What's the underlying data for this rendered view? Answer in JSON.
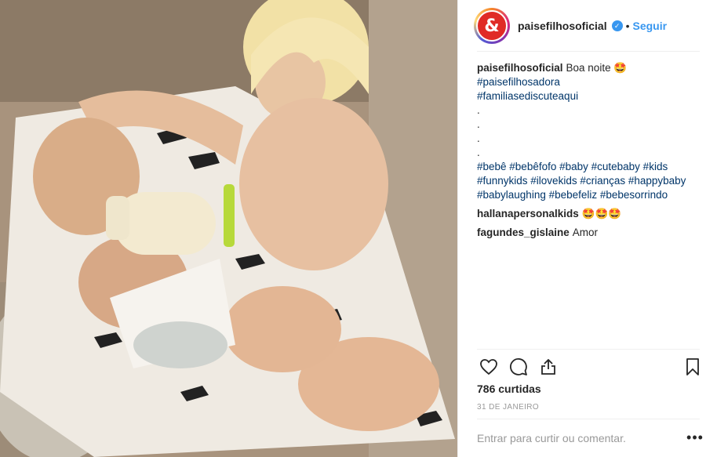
{
  "header": {
    "avatar_glyph": "&",
    "username": "paisefilhosoficial",
    "verified_mark": "✓",
    "separator": "•",
    "follow_label": "Seguir"
  },
  "caption": {
    "username": "paisefilhosoficial",
    "text": "Boa noite 🤩",
    "tags_a": [
      "#paisefilhosadora",
      "#familiasediscuteaqui"
    ],
    "dots": [
      ".",
      ".",
      ".",
      "."
    ],
    "tag_lines": [
      "#bebê #bebêfofo #baby #cutebaby #kids",
      "#funnykids #ilovekids #crianças #happybaby",
      "#babylaughing #bebefeliz #bebesorrindo"
    ]
  },
  "comments": [
    {
      "username": "hallanapersonalkids",
      "text": "🤩🤩🤩"
    },
    {
      "username": "fagundes_gislaine",
      "text": "Amor"
    }
  ],
  "actions": {
    "icons": [
      "heart-icon",
      "comment-icon",
      "share-icon",
      "bookmark-icon"
    ]
  },
  "likes": "786 curtidas",
  "date": "31 DE JANEIRO",
  "comment_box": {
    "placeholder": "Entrar para curtir ou comentar.",
    "more_glyph": "•••"
  },
  "colors": {
    "link": "#003569",
    "follow": "#3897f0",
    "avatar": "#e02b26"
  }
}
